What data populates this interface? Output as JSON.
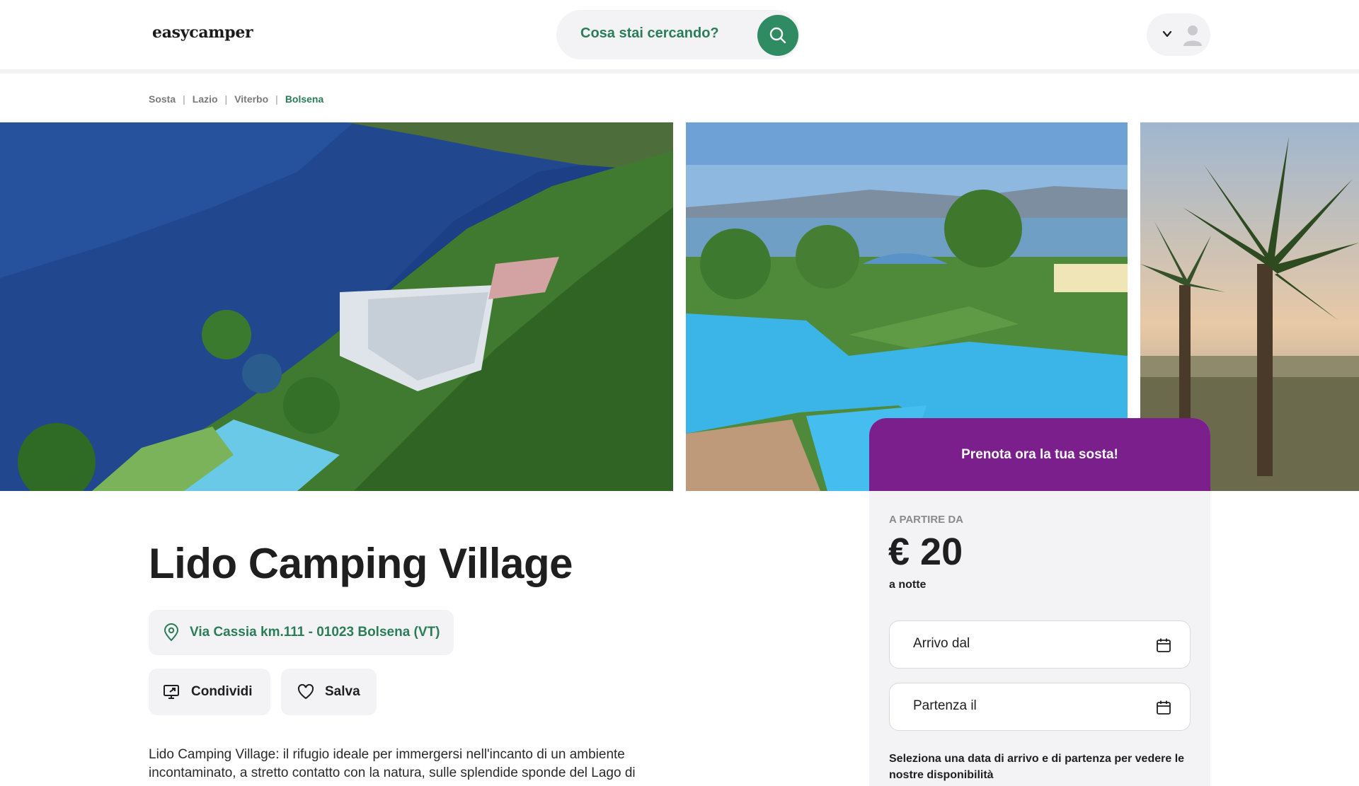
{
  "header": {
    "logo": "easycamper",
    "search_placeholder": "Cosa stai cercando?",
    "icons": {
      "search": "search-icon",
      "menu": "chevron-down-icon",
      "user": "user-avatar-icon"
    }
  },
  "breadcrumb": {
    "items": [
      "Sosta",
      "Lazio",
      "Viterbo",
      "Bolsena"
    ],
    "separator": "|"
  },
  "listing": {
    "title": "Lido Camping Village",
    "address": "Via Cassia km.111 - 01023 Bolsena (VT)",
    "share_label": "Condividi",
    "save_label": "Salva",
    "description": "Lido Camping Village: il rifugio ideale per immergersi nell'incanto di un ambiente incontaminato, a stretto contatto con la natura, sulle splendide sponde del Lago di"
  },
  "gallery": {
    "photos": [
      "aerial-lake-view-photo",
      "swimming-pools-photo",
      "palm-trees-sunset-photo"
    ]
  },
  "booking": {
    "header": "Prenota ora la tua sosta!",
    "from_label": "A PARTIRE DA",
    "price": "€ 20",
    "per_night": "a notte",
    "arrival_label": "Arrivo dal",
    "departure_label": "Partenza il",
    "hint": "Seleziona una data di arrivo e di partenza per vedere le nostre disponibilità"
  },
  "colors": {
    "brand_green": "#2a7d57",
    "booking_purple": "#7a1f8c",
    "surface": "#f3f3f6"
  }
}
